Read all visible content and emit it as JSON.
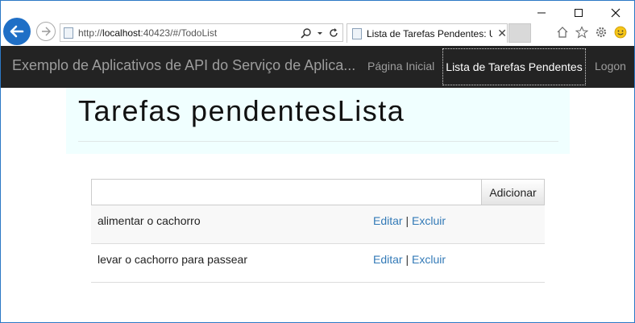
{
  "browser": {
    "window_controls": {
      "minimize": "—",
      "maximize": "☐",
      "close": "✕"
    },
    "address": {
      "scheme": "http://",
      "host": "localhost",
      "rest": ":40423/#/TodoList"
    },
    "tab": {
      "title": "Lista de Tarefas Pendentes: U...",
      "close": "✕"
    }
  },
  "navbar": {
    "brand": "Exemplo de Aplicativos de API do Serviço de Aplica...",
    "home": "Página Inicial",
    "todo": "Lista de Tarefas Pendentes",
    "login": "Logon"
  },
  "page": {
    "title": "Tarefas pendentesLista",
    "input_value": "",
    "add_label": "Adicionar",
    "items": [
      {
        "name": "alimentar o cachorro",
        "edit": "Editar",
        "separator": "|",
        "delete": "Excluir"
      },
      {
        "name": "levar o cachorro para passear",
        "edit": "Editar",
        "separator": "|",
        "delete": "Excluir"
      }
    ]
  },
  "colors": {
    "accent": "#1f6fc6",
    "navbar": "#232323",
    "jumbotron": "#f0ffff",
    "link": "#337ab7"
  }
}
